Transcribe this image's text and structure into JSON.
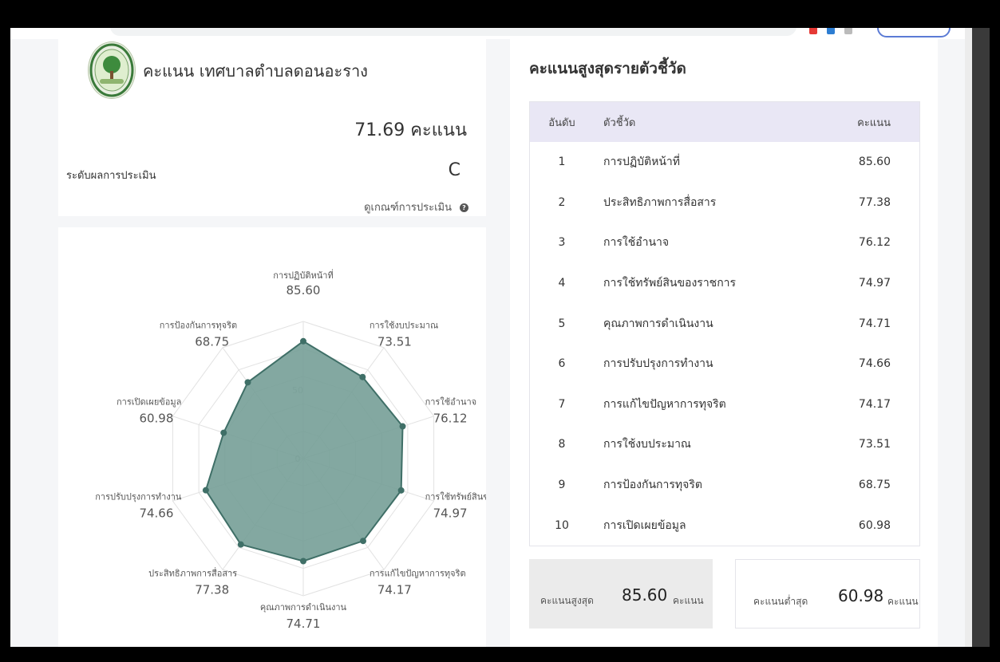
{
  "colors": {
    "accent": "#3f6f67",
    "fill": "#769e97",
    "header_bg": "#e9e7f5",
    "grid": "#e2e2e2"
  },
  "header": {
    "title": "คะแนน เทศบาลตำบลดอนอะราง",
    "score_value": "71.69",
    "score_unit": "คะแนน",
    "level_label": "ระดับผลการประเมิน",
    "level_value": "C",
    "criteria_link": "ดูเกณฑ์การประเมิน",
    "help_icon": "question-circle-icon",
    "logo_icon": "municipality-seal-icon"
  },
  "ranking": {
    "title": "คะแนนสูงสุดรายตัวชี้วัด",
    "columns": [
      "อันดับ",
      "ตัวชี้วัด",
      "คะแนน"
    ],
    "rows": [
      {
        "rank": "1",
        "name": "การปฏิบัติหน้าที่",
        "score": "85.60"
      },
      {
        "rank": "2",
        "name": "ประสิทธิภาพการสื่อสาร",
        "score": "77.38"
      },
      {
        "rank": "3",
        "name": "การใช้อำนาจ",
        "score": "76.12"
      },
      {
        "rank": "4",
        "name": "การใช้ทรัพย์สินของราชการ",
        "score": "74.97"
      },
      {
        "rank": "5",
        "name": "คุณภาพการดำเนินงาน",
        "score": "74.71"
      },
      {
        "rank": "6",
        "name": "การปรับปรุงการทำงาน",
        "score": "74.66"
      },
      {
        "rank": "7",
        "name": "การแก้ไขปัญหาการทุจริต",
        "score": "74.17"
      },
      {
        "rank": "8",
        "name": "การใช้งบประมาณ",
        "score": "73.51"
      },
      {
        "rank": "9",
        "name": "การป้องกันการทุจริต",
        "score": "68.75"
      },
      {
        "rank": "10",
        "name": "การเปิดเผยข้อมูล",
        "score": "60.98"
      }
    ]
  },
  "summary": {
    "max_label": "คะแนนสูงสุด",
    "max_value": "85.60",
    "max_unit": "คะแนน",
    "min_label": "คะแนนต่ำสุด",
    "min_value": "60.98",
    "min_unit": "คะแนน"
  },
  "chart_data": {
    "type": "radar",
    "min": 0,
    "max": 100,
    "ticks": [
      0,
      50
    ],
    "grid": true,
    "axes": [
      {
        "label": "การปฏิบัติหน้าที่",
        "value": 85.6
      },
      {
        "label": "การใช้งบประมาณ",
        "value": 73.51
      },
      {
        "label": "การใช้อำนาจ",
        "value": 76.12
      },
      {
        "label": "การใช้ทรัพย์สินข",
        "value": 74.97
      },
      {
        "label": "การแก้ไขปัญหาการทุจริต",
        "value": 74.17
      },
      {
        "label": "คุณภาพการดำเนินงาน",
        "value": 74.71
      },
      {
        "label": "ประสิทธิภาพการสื่อสาร",
        "value": 77.38
      },
      {
        "label": "การปรับปรุงการทำงาน",
        "value": 74.66
      },
      {
        "label": "การเปิดเผยข้อมูล",
        "value": 60.98
      },
      {
        "label": "การป้องกันการทุจริต",
        "value": 68.75
      }
    ]
  }
}
